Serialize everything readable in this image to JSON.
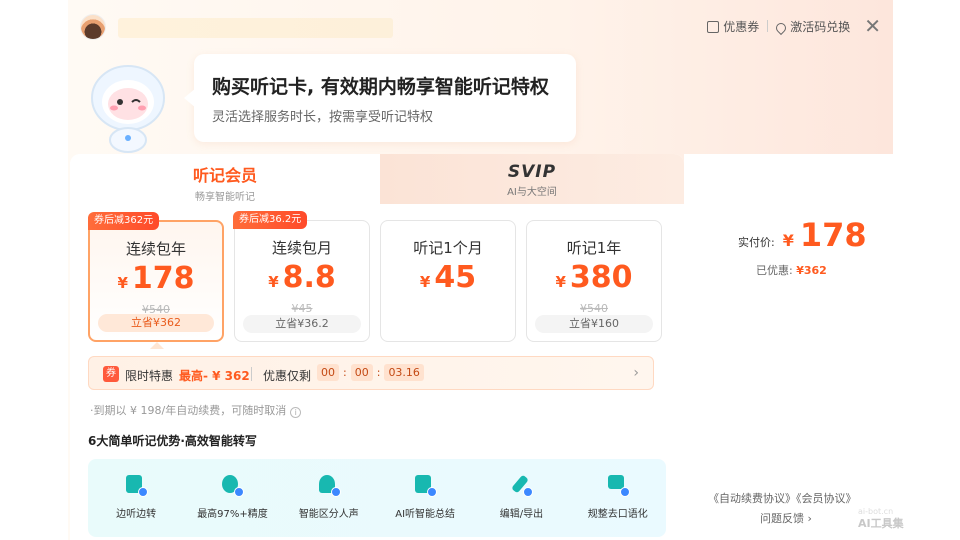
{
  "header": {
    "coupon_label": "优惠券",
    "redeem_label": "激活码兑换",
    "close_glyph": "✕"
  },
  "bubble": {
    "title": "购买听记卡, 有效期内畅享智能听记特权",
    "subtitle": "灵活选择服务时长，按需享受听记特权"
  },
  "tabs": [
    {
      "title": "听记会员",
      "subtitle": "畅享智能听记"
    },
    {
      "title": "SVIP",
      "subtitle": "AI与大空间"
    }
  ],
  "plans": [
    {
      "tag": "券后减362元",
      "name": "连续包年",
      "currency": "¥",
      "price": "178",
      "original": "¥540",
      "save": "立省¥362"
    },
    {
      "tag": "券后减36.2元",
      "name": "连续包月",
      "currency": "¥",
      "price": "8.8",
      "original": "¥45",
      "save": "立省¥36.2"
    },
    {
      "tag": "",
      "name": "听记1个月",
      "currency": "¥",
      "price": "45",
      "original": "",
      "save": ""
    },
    {
      "tag": "",
      "name": "听记1年",
      "currency": "¥",
      "price": "380",
      "original": "¥540",
      "save": "立省¥160"
    }
  ],
  "promo": {
    "badge": "券",
    "label": "限时特惠",
    "max": "最高- ¥ 362",
    "remaining": "优惠仅剩",
    "timer": [
      "00",
      "00",
      "03.16"
    ],
    "chevron": "›"
  },
  "renew_note": "·到期以 ¥ 198/年自动续费，可随时取消",
  "info_glyph": "i",
  "advantages": {
    "title": "6大简单听记优势·高效智能转写",
    "items": [
      {
        "label": "边听边转",
        "icon": "record-icon"
      },
      {
        "label": "最高97%+精度",
        "icon": "target-icon"
      },
      {
        "label": "智能区分人声",
        "icon": "speaker-icon"
      },
      {
        "label": "AI听智能总结",
        "icon": "ai-doc-icon"
      },
      {
        "label": "编辑/导出",
        "icon": "edit-icon"
      },
      {
        "label": "规整去口语化",
        "icon": "text-icon"
      }
    ]
  },
  "side": {
    "paid_label": "实付价:",
    "currency": "¥",
    "paid_value": "178",
    "discount_label": "已优惠:",
    "discount_value": "¥362",
    "agreements": "《自动续费协议》《会员协议》",
    "feedback": "问题反馈 ›"
  },
  "watermark": {
    "line1": "ai-bot.cn",
    "line2": "AI工具集"
  },
  "colors": {
    "accent": "#ff5a1f",
    "feature_teal": "#18b8b0",
    "feature_blue": "#3c88ff"
  }
}
